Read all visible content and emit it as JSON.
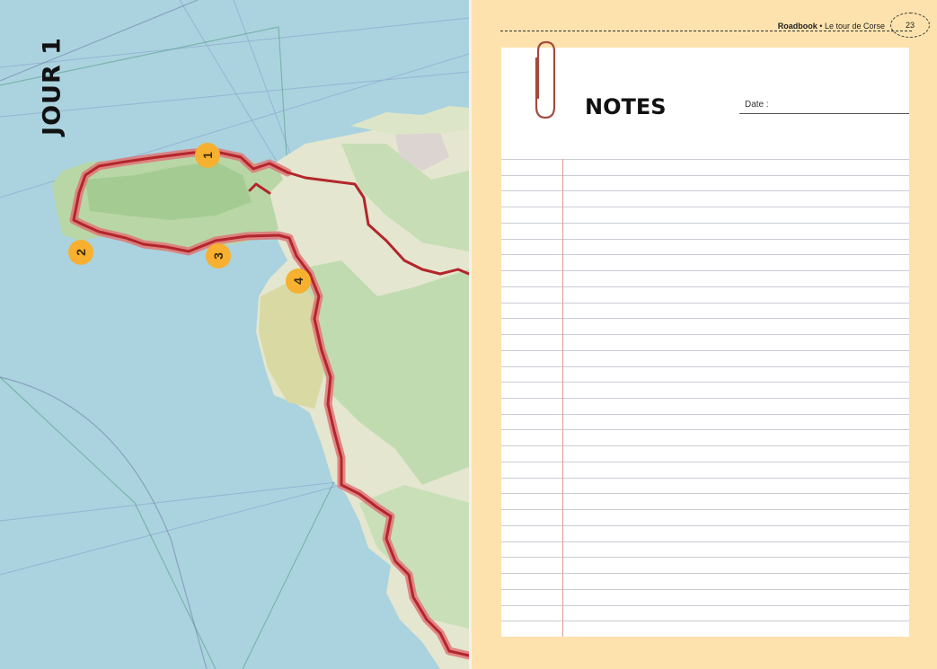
{
  "map": {
    "day_title": "JOUR 1",
    "markers": [
      {
        "label": "1"
      },
      {
        "label": "2"
      },
      {
        "label": "3"
      },
      {
        "label": "4"
      }
    ],
    "colors": {
      "sea": "#aad3df",
      "land": "#e9ecd2",
      "forest": "#add19e",
      "route": "#b3262b",
      "route_halo": "#e07478",
      "marker": "#f7b02f"
    }
  },
  "header": {
    "brand": "Roadbook",
    "separator": " • ",
    "subtitle": "Le tour de Corse",
    "page_number": "23"
  },
  "notes": {
    "title": "NOTES",
    "date_label": "Date :",
    "line_count": 30
  }
}
